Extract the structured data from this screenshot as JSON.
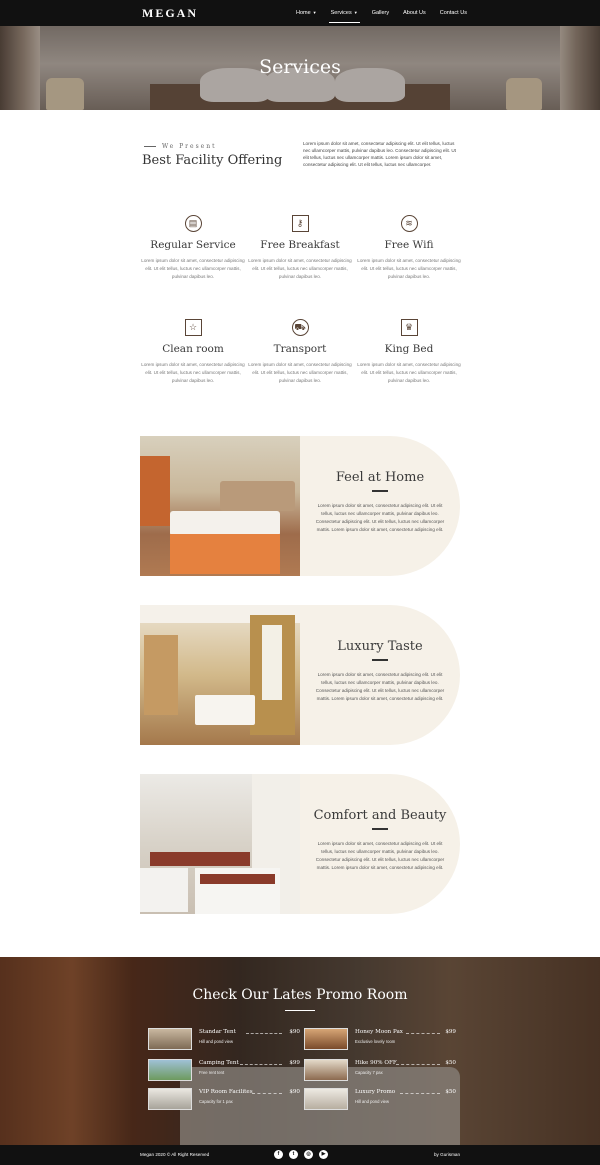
{
  "brand": "MEGAN",
  "nav": {
    "items": [
      {
        "label": "Home",
        "has_dropdown": true,
        "active": false
      },
      {
        "label": "Services",
        "has_dropdown": true,
        "active": true
      },
      {
        "label": "Gallery",
        "has_dropdown": false,
        "active": false
      },
      {
        "label": "About Us",
        "has_dropdown": false,
        "active": false
      },
      {
        "label": "Contact Us",
        "has_dropdown": false,
        "active": false
      }
    ]
  },
  "hero": {
    "title": "Services"
  },
  "intro": {
    "eyebrow": "We Present",
    "heading": "Best Facility Offering",
    "text": "Lorem ipsum dolor sit amet, consectetur adipiscing elit. Ut elit tellus, luctus nec ullamcorper mattis, pulvinar dapibus leo. Consectetur adipiscing elit. Ut elit tellus, luctus nec ullamcorper mattis. Lorem ipsum dolor sit amet, consectetur adipiscing elit. Ut elit tellus, luctus nec ullamcorper."
  },
  "facilities": [
    {
      "icon": "door-icon",
      "title": "Regular Service",
      "text": "Lorem ipsum dolor sit amet, consectetur adipiscing elit. Ut elit tellus, luctus nec ullamcorper mattis, pulvinar dapibus leo."
    },
    {
      "icon": "key-icon",
      "title": "Free Breakfast",
      "text": "Lorem ipsum dolor sit amet, consectetur adipiscing elit. Ut elit tellus, luctus nec ullamcorper mattis, pulvinar dapibus leo."
    },
    {
      "icon": "wifi-icon",
      "title": "Free Wifi",
      "text": "Lorem ipsum dolor sit amet, consectetur adipiscing elit. Ut elit tellus, luctus nec ullamcorper mattis, pulvinar dapibus leo."
    },
    {
      "icon": "star-icon",
      "title": "Clean room",
      "text": "Lorem ipsum dolor sit amet, consectetur adipiscing elit. Ut elit tellus, luctus nec ullamcorper mattis, pulvinar dapibus leo."
    },
    {
      "icon": "car-icon",
      "title": "Transport",
      "text": "Lorem ipsum dolor sit amet, consectetur adipiscing elit. Ut elit tellus, luctus nec ullamcorper mattis, pulvinar dapibus leo."
    },
    {
      "icon": "crown-icon",
      "title": "King Bed",
      "text": "Lorem ipsum dolor sit amet, consectetur adipiscing elit. Ut elit tellus, luctus nec ullamcorper mattis, pulvinar dapibus leo."
    }
  ],
  "features": [
    {
      "title": "Feel at Home",
      "text": "Lorem ipsum dolor sit amet, consectetur adipiscing elit. Ut elit tellus, luctus nec ullamcorper mattis, pulvinar dapibus leo. Consectetur adipiscing elit. Ut elit tellus, luctus nec ullamcorper mattis. Lorem ipsum dolor sit amet, consectetur adipiscing elit."
    },
    {
      "title": "Luxury Taste",
      "text": "Lorem ipsum dolor sit amet, consectetur adipiscing elit. Ut elit tellus, luctus nec ullamcorper mattis, pulvinar dapibus leo. Consectetur adipiscing elit. Ut elit tellus, luctus nec ullamcorper mattis. Lorem ipsum dolor sit amet, consectetur adipiscing elit."
    },
    {
      "title": "Comfort and Beauty",
      "text": "Lorem ipsum dolor sit amet, consectetur adipiscing elit. Ut elit tellus, luctus nec ullamcorper mattis, pulvinar dapibus leo. Consectetur adipiscing elit. Ut elit tellus, luctus nec ullamcorper mattis. Lorem ipsum dolor sit amet, consectetur adipiscing elit."
    }
  ],
  "promo": {
    "title": "Check Our Lates Promo Room",
    "items": [
      {
        "name": "Standar Tent",
        "price": "$90",
        "sub": "Hill and pond view"
      },
      {
        "name": "Honey Moon Pax",
        "price": "$99",
        "sub": "Exclusive lovely room"
      },
      {
        "name": "Camping Tent",
        "price": "$99",
        "sub": "Free rent tent"
      },
      {
        "name": "Hike 90% OFF",
        "price": "$50",
        "sub": "Capacity 7 pax"
      },
      {
        "name": "VIP Room Facilites",
        "price": "$90",
        "sub": "Capacity for 1 pax"
      },
      {
        "name": "Luxury Promo",
        "price": "$50",
        "sub": "Hill and pond view"
      }
    ]
  },
  "footer": {
    "copyright": "Megan 2020 © All Right Reserved",
    "credit": "by Gurisman",
    "socials": [
      "facebook-icon",
      "twitter-icon",
      "instagram-icon",
      "youtube-icon"
    ]
  },
  "colors": {
    "accent": "#5a4537",
    "panel": "#f6f1e8",
    "nav_bg": "#111111"
  }
}
